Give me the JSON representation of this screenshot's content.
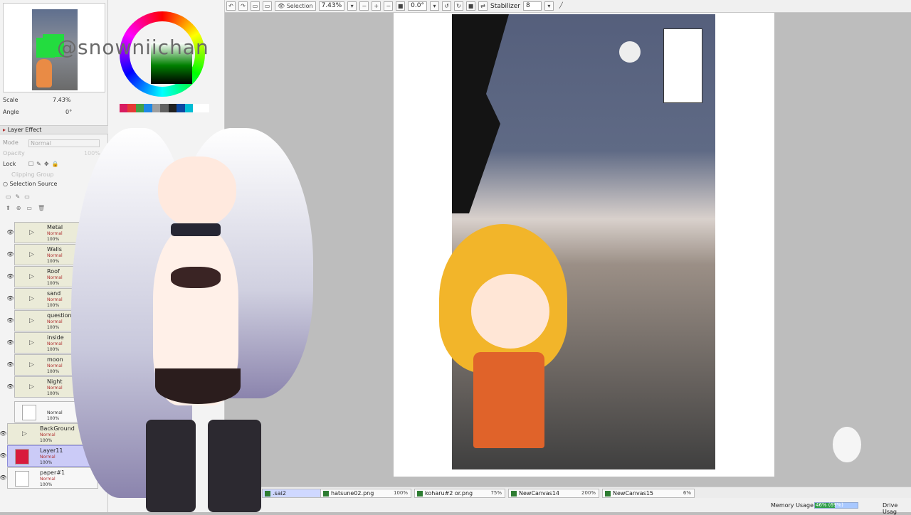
{
  "toolbar": {
    "selection_label": "Selection",
    "zoom_value": "7.43%",
    "angle_value": "0.0°",
    "stabilizer_label": "Stabilizer",
    "stabilizer_value": "8"
  },
  "navigator": {
    "scale_label": "Scale",
    "scale_value": "7.43%",
    "angle_label": "Angle",
    "angle_value": "0°"
  },
  "layer_panel": {
    "section_label": "Layer Effect",
    "mode_label": "Mode",
    "mode_value": "Normal",
    "opacity_label": "Opacity",
    "opacity_value": "100%",
    "lock_label": "Lock",
    "clipping_group_label": "Clipping Group",
    "selection_source_label": "Selection Source",
    "layers": [
      {
        "name": "Metal",
        "mode": "Normal",
        "opacity": "100%",
        "folder": true
      },
      {
        "name": "Walls",
        "mode": "Normal",
        "opacity": "100%",
        "folder": true
      },
      {
        "name": "Roof",
        "mode": "Normal",
        "opacity": "100%",
        "folder": true
      },
      {
        "name": "sand",
        "mode": "Normal",
        "opacity": "100%",
        "folder": true
      },
      {
        "name": "question",
        "mode": "Normal",
        "opacity": "100%",
        "folder": true
      },
      {
        "name": "inside",
        "mode": "Normal",
        "opacity": "100%",
        "folder": true
      },
      {
        "name": "moon",
        "mode": "Normal",
        "opacity": "100%",
        "folder": true
      },
      {
        "name": "Night",
        "mode": "Normal",
        "opacity": "100%",
        "folder": true
      },
      {
        "name": "",
        "mode": "Normal",
        "opacity": "100%",
        "folder": false
      },
      {
        "name": "BackGround",
        "mode": "Normal",
        "opacity": "100%",
        "folder": true
      },
      {
        "name": "Layer11",
        "mode": "Normal",
        "opacity": "100%",
        "folder": false,
        "selected": true
      },
      {
        "name": "paper#1",
        "mode": "Normal",
        "opacity": "100%",
        "folder": false
      }
    ]
  },
  "watermark": "@snowniichan",
  "tabs": [
    {
      "name": ".sai2",
      "zoom": "7%"
    },
    {
      "name": "hatsune02.png",
      "zoom": "100%"
    },
    {
      "name": "koharu#2 or.png",
      "zoom": "75%"
    },
    {
      "name": "NewCanvas14",
      "zoom": "200%"
    },
    {
      "name": "NewCanvas15",
      "zoom": "6%"
    }
  ],
  "status": {
    "memory_label": "Memory Usage",
    "memory_value": "46% (69%)",
    "drive_label": "Drive Usag"
  },
  "colors": {
    "swatches": [
      "#d81b60",
      "#e53935",
      "#43a047",
      "#1e88e5",
      "#9e9e9e",
      "#616161",
      "#212121",
      "#0d47a1",
      "#00bcd4",
      "#ffffff",
      "#ffffff"
    ]
  }
}
